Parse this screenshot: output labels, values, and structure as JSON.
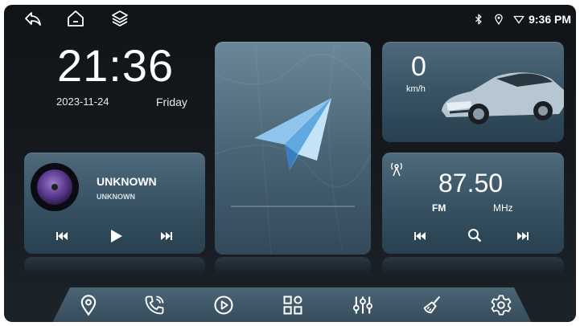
{
  "status": {
    "time": "9:36 PM"
  },
  "clock": {
    "time": "21:36",
    "date": "2023-11-24",
    "weekday": "Friday"
  },
  "music": {
    "title": "UNKNOWN",
    "artist": "UNKNOWN"
  },
  "speed": {
    "value": "0",
    "unit": "km/h"
  },
  "radio": {
    "frequency": "87.50",
    "band": "FM",
    "unit": "MHz"
  },
  "colors": {
    "accent": "#3a5566",
    "text": "#ffffff"
  },
  "icons": [
    "back-icon",
    "home-icon",
    "layers-icon",
    "bluetooth-icon",
    "location-icon",
    "wifi-icon",
    "play-icon",
    "search-icon",
    "grid-icon",
    "equalizer-icon",
    "settings-icon"
  ]
}
